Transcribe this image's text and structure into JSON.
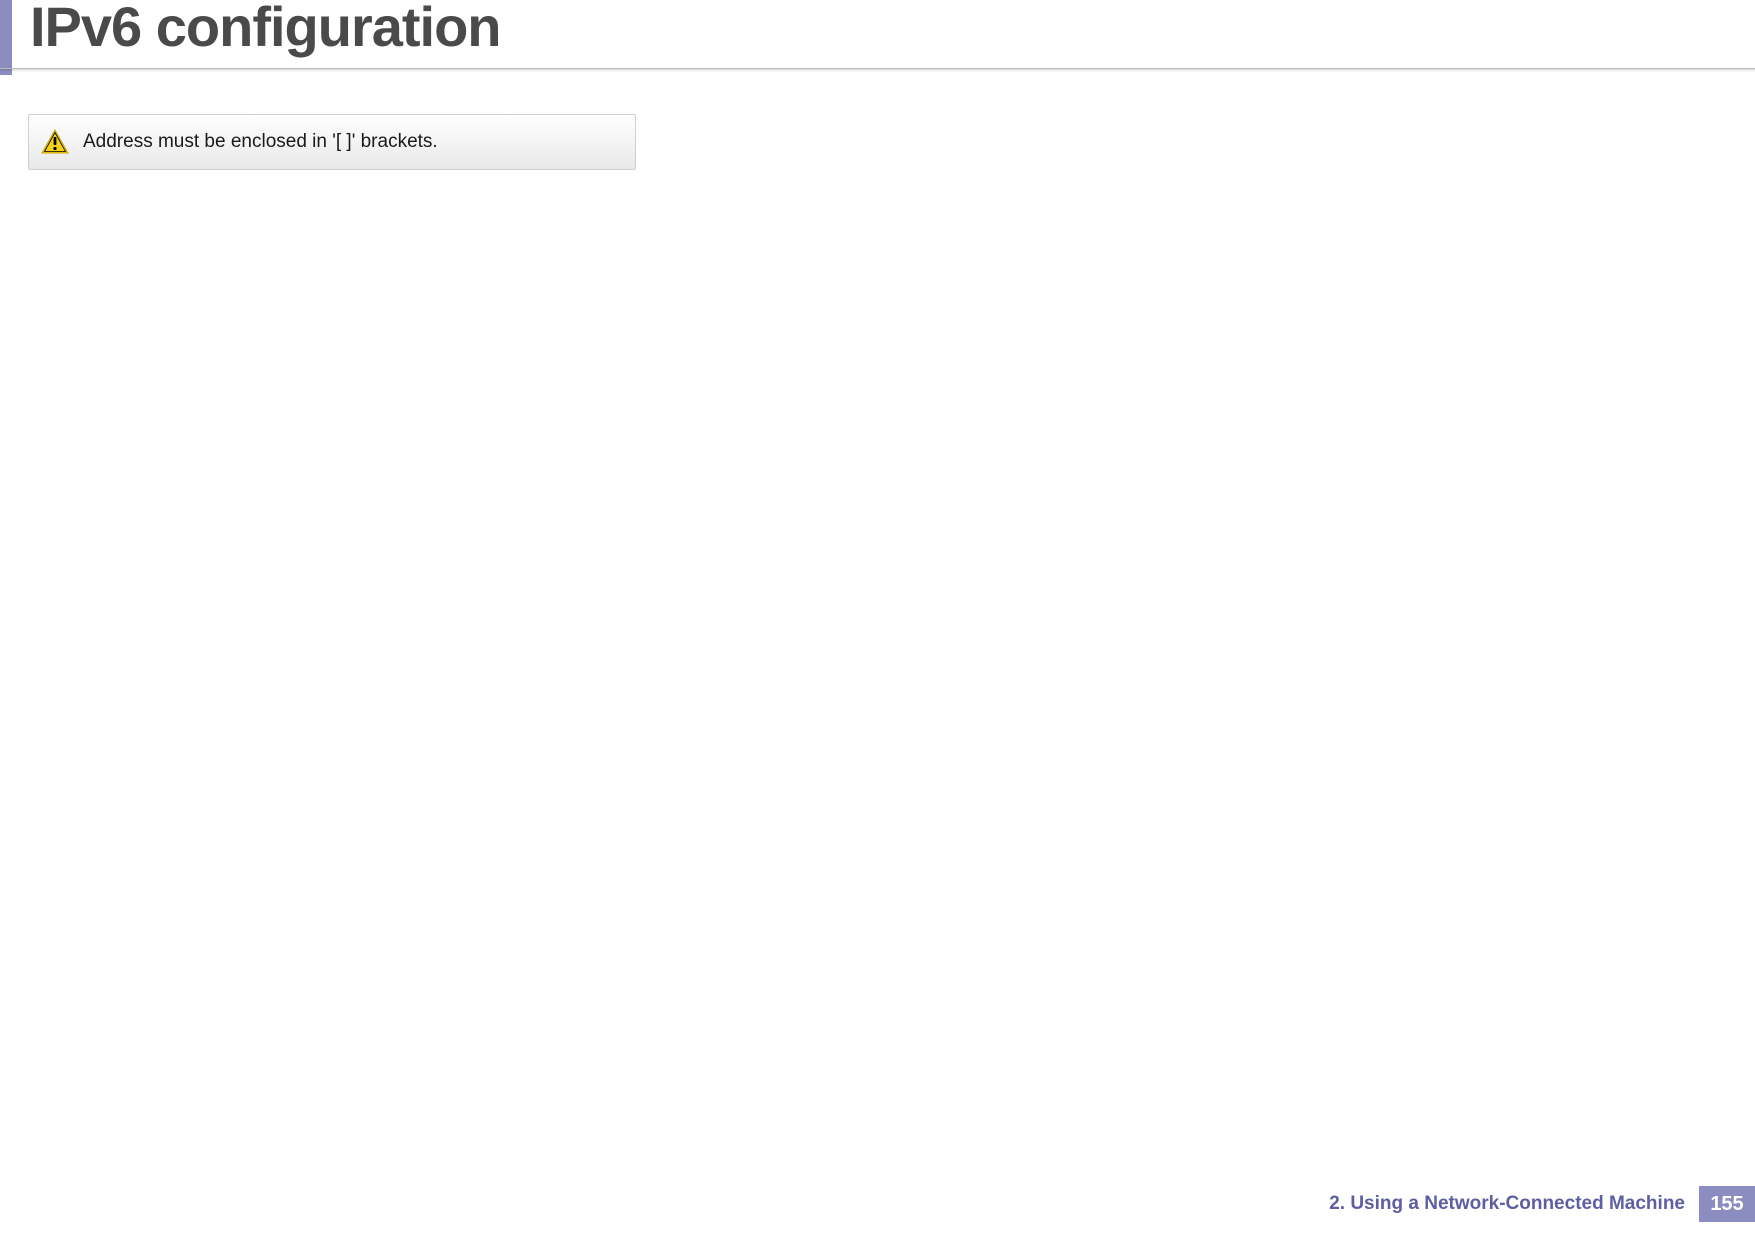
{
  "header": {
    "title": "IPv6 configuration"
  },
  "caution": {
    "text": "Address must be enclosed in '[ ]' brackets."
  },
  "footer": {
    "chapter_text": "2.  Using a Network-Connected Machine",
    "page_number": "155"
  }
}
